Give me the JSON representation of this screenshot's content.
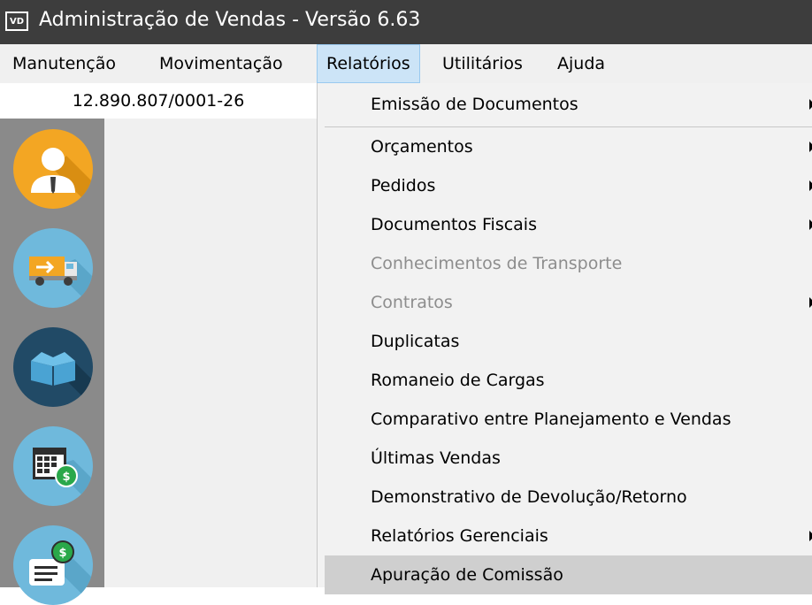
{
  "window": {
    "app_icon_text": "VD",
    "title": "Administração de Vendas - Versão 6.63"
  },
  "menubar": {
    "items": [
      {
        "label": "Manutenção"
      },
      {
        "label": "Movimentação"
      },
      {
        "label": "Relatórios"
      },
      {
        "label": "Utilitários"
      },
      {
        "label": "Ajuda"
      }
    ],
    "active": "Relatórios"
  },
  "company": {
    "cnpj": "12.890.807/0001-26"
  },
  "shortcuts": [
    {
      "icon": "user-icon",
      "color": "#f3a623"
    },
    {
      "icon": "truck-icon",
      "color": "#6fb9dc"
    },
    {
      "icon": "box-icon",
      "color": "#214a66"
    },
    {
      "icon": "calendar-money-icon",
      "color": "#6fb9dc"
    },
    {
      "icon": "money-document-icon",
      "color": "#6fb9dc"
    }
  ],
  "reports_menu": {
    "items": [
      {
        "label": "Emissão de Documentos",
        "submenu": true,
        "disabled": false
      },
      {
        "label": "Orçamentos",
        "submenu": true,
        "disabled": false
      },
      {
        "label": "Pedidos",
        "submenu": true,
        "disabled": false
      },
      {
        "label": "Documentos Fiscais",
        "submenu": true,
        "disabled": false
      },
      {
        "label": "Conhecimentos de Transporte",
        "submenu": false,
        "disabled": true
      },
      {
        "label": "Contratos",
        "submenu": true,
        "disabled": true
      },
      {
        "label": "Duplicatas",
        "submenu": false,
        "disabled": false
      },
      {
        "label": "Romaneio de Cargas",
        "submenu": false,
        "disabled": false
      },
      {
        "label": "Comparativo entre Planejamento e Vendas",
        "submenu": false,
        "disabled": false
      },
      {
        "label": "Últimas Vendas",
        "submenu": false,
        "disabled": false
      },
      {
        "label": "Demonstrativo de Devolução/Retorno",
        "submenu": false,
        "disabled": false
      },
      {
        "label": "Relatórios Gerenciais",
        "submenu": true,
        "disabled": false
      },
      {
        "label": "Apuração de Comissão",
        "submenu": false,
        "disabled": false,
        "highlighted": true
      }
    ]
  }
}
